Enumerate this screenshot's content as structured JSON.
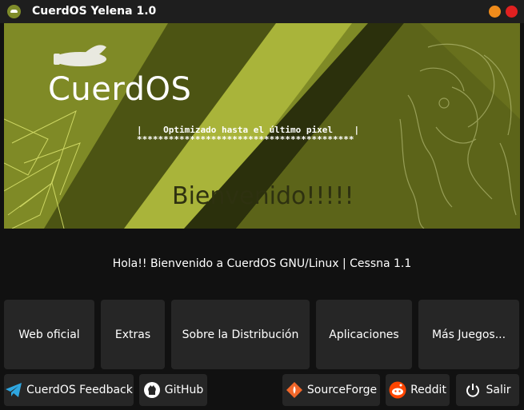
{
  "window": {
    "title": "CuerdOS Yelena 1.0"
  },
  "banner": {
    "logo_text": "CuerdOS",
    "tagline_line1": "|    Optimizado hasta el último pixel    |",
    "tagline_line2": "*****************************************",
    "welcome": "Bienvenido!!!!!"
  },
  "greeting": "Hola!! Bienvenido a CuerdOS GNU/Linux | Cessna 1.1",
  "main_buttons": {
    "web": "Web oficial",
    "extras": "Extras",
    "sobre": "Sobre la Distribución",
    "apps": "Aplicaciones",
    "juegos": "Más Juegos..."
  },
  "bottom_buttons": {
    "feedback": "CuerdOS Feedback",
    "github": "GitHub",
    "sourceforge": "SourceForge",
    "reddit": "Reddit",
    "salir": "Salir"
  },
  "colors": {
    "banner": "#7f8a26",
    "minimize": "#f08c1b",
    "close": "#e02020",
    "button_bg": "#262626"
  },
  "icons": [
    "app-icon",
    "minimize-icon",
    "close-icon",
    "telegram-icon",
    "github-icon",
    "sourceforge-icon",
    "reddit-icon",
    "power-icon"
  ]
}
